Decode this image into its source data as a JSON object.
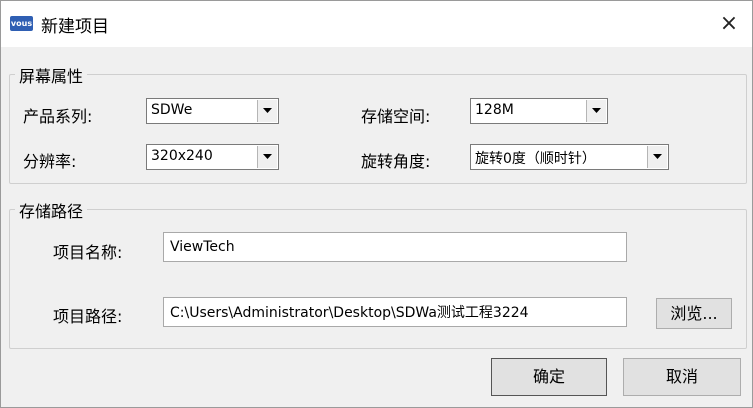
{
  "window": {
    "title": "新建项目",
    "icon_text": "vous",
    "close_glyph": "×"
  },
  "screen_group": {
    "title": "屏幕属性",
    "product_series_label": "产品系列:",
    "product_series_value": "SDWe",
    "storage_label": "存储空间:",
    "storage_value": "128M",
    "resolution_label": "分辨率:",
    "resolution_value": "320x240",
    "rotation_label": "旋转角度:",
    "rotation_value": "旋转0度（顺时针）"
  },
  "path_group": {
    "title": "存储路径",
    "project_name_label": "项目名称:",
    "project_name_value": "ViewTech",
    "project_path_label": "项目路径:",
    "project_path_value": "C:\\Users\\Administrator\\Desktop\\SDWa测试工程3224",
    "browse_label": "浏览..."
  },
  "footer": {
    "ok_label": "确定",
    "cancel_label": "取消"
  }
}
